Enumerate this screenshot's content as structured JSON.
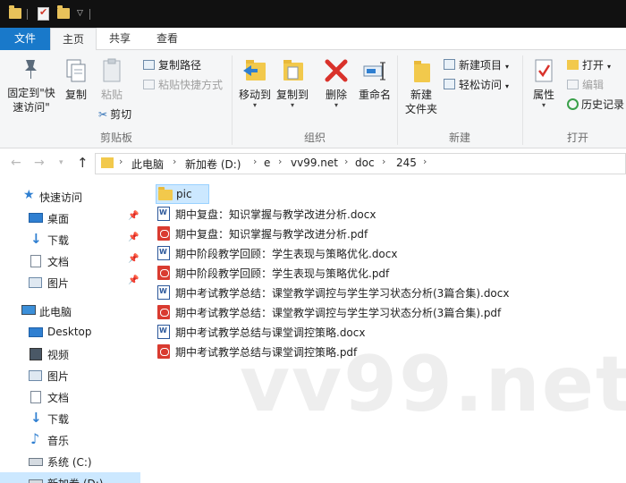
{
  "ribbon_tabs": {
    "file": "文件",
    "home": "主页",
    "share": "共享",
    "view": "查看"
  },
  "ribbon": {
    "clipboard": {
      "pin_quick_access": [
        "固定到\"快",
        "速访问\""
      ],
      "copy": "复制",
      "paste": "粘贴",
      "copy_path": "复制路径",
      "paste_shortcut": "粘贴快捷方式",
      "cut": "剪切",
      "label": "剪贴板"
    },
    "organize": {
      "move_to": "移动到",
      "copy_to": "复制到",
      "delete": "删除",
      "rename": "重命名",
      "label": "组织"
    },
    "new": {
      "new_folder": [
        "新建",
        "文件夹"
      ],
      "new_item": "新建项目",
      "easy_access": "轻松访问",
      "label": "新建"
    },
    "open": {
      "properties": "属性",
      "open": "打开",
      "edit": "编辑",
      "history": "历史记录",
      "label": "打开"
    }
  },
  "address": {
    "crumbs": [
      "此电脑",
      "新加卷 (D:)",
      "e",
      "vv99.net",
      "doc",
      "245"
    ]
  },
  "navpane": {
    "quick_access": "快速访问",
    "quick_items": [
      "桌面",
      "下载",
      "文档",
      "图片"
    ],
    "this_pc": "此电脑",
    "pc_items": [
      "Desktop",
      "视频",
      "图片",
      "文档",
      "下载",
      "音乐",
      "系统 (C:)",
      "新加卷 (D:)"
    ]
  },
  "files": [
    {
      "name": "pic",
      "type": "folder"
    },
    {
      "name": "期中复盘：知识掌握与教学改进分析.docx",
      "type": "docx"
    },
    {
      "name": "期中复盘：知识掌握与教学改进分析.pdf",
      "type": "pdf"
    },
    {
      "name": "期中阶段教学回顾：学生表现与策略优化.docx",
      "type": "docx"
    },
    {
      "name": "期中阶段教学回顾：学生表现与策略优化.pdf",
      "type": "pdf"
    },
    {
      "name": "期中考试教学总结：课堂教学调控与学生学习状态分析(3篇合集).docx",
      "type": "docx"
    },
    {
      "name": "期中考试教学总结：课堂教学调控与学生学习状态分析(3篇合集).pdf",
      "type": "pdf"
    },
    {
      "name": "期中考试教学总结与课堂调控策略.docx",
      "type": "docx"
    },
    {
      "name": "期中考试教学总结与课堂调控策略.pdf",
      "type": "pdf"
    }
  ],
  "watermark": "vv99.net",
  "colors": {
    "file_tab": "#1979ca",
    "selection": "#cce8ff",
    "folder": "#f2c94c",
    "pdf": "#d93b30",
    "docx": "#2b579a"
  }
}
